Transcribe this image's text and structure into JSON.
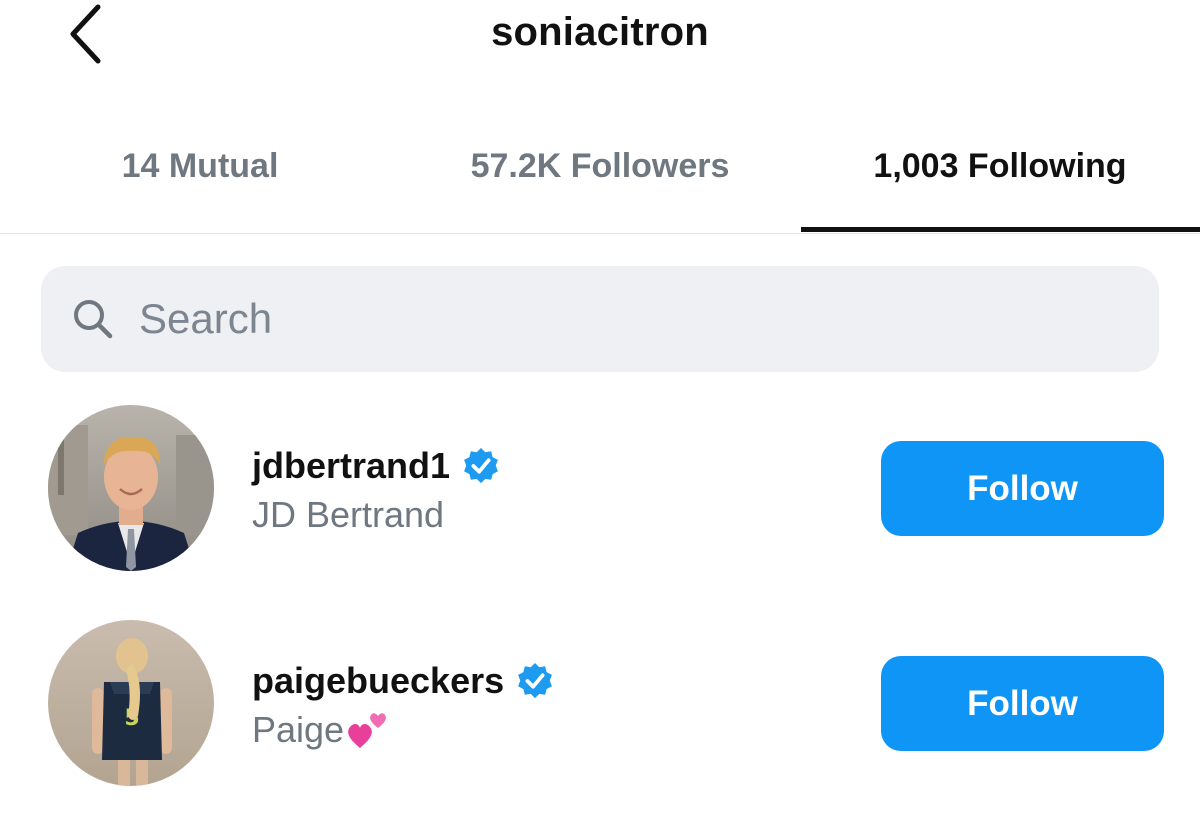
{
  "header": {
    "title": "soniacitron",
    "back_icon": "chevron-left-icon"
  },
  "tabs": [
    {
      "label": "14 Mutual",
      "active": false
    },
    {
      "label": "57.2K Followers",
      "active": false
    },
    {
      "label": "1,003 Following",
      "active": true
    }
  ],
  "search": {
    "placeholder": "Search",
    "value": "",
    "icon": "search-icon"
  },
  "list": [
    {
      "username": "jdbertrand1",
      "full_name": "JD Bertrand",
      "verified": true,
      "button_label": "Follow"
    },
    {
      "username": "paigebueckers",
      "full_name": "Paige",
      "full_name_emoji": "two-hearts-icon",
      "verified": true,
      "button_label": "Follow"
    }
  ],
  "colors": {
    "accent": "#0f95f6",
    "verified": "#1d9bf0",
    "muted_text": "#6f7780",
    "search_bg": "#eef0f3"
  }
}
